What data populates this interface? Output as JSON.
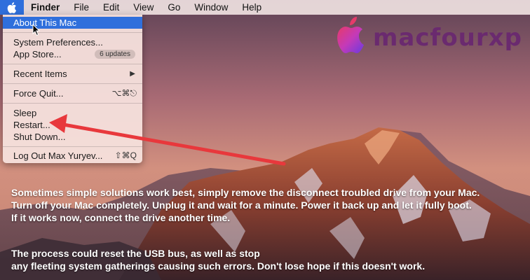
{
  "menubar": {
    "items": [
      "Finder",
      "File",
      "Edit",
      "View",
      "Go",
      "Window",
      "Help"
    ]
  },
  "apple_menu": {
    "about": "About This Mac",
    "system_preferences": "System Preferences...",
    "app_store": "App Store...",
    "app_store_badge": "6 updates",
    "recent_items": "Recent Items",
    "recent_items_arrow": "▶",
    "force_quit": "Force Quit...",
    "force_quit_shortcut": "⌥⌘⎋",
    "sleep": "Sleep",
    "restart": "Restart...",
    "shut_down": "Shut Down...",
    "log_out": "Log Out Max Yuryev...",
    "log_out_shortcut": "⇧⌘Q"
  },
  "watermark": {
    "text": "macfourxp"
  },
  "caption": {
    "line1": "Sometimes simple solutions work best, simply remove the disconnect troubled drive from your Mac.",
    "line2": "Turn off your Mac completely. Unplug it and wait for a minute. Power it back up and let it fully boot.",
    "line3": "If it works now, connect the drive another time.",
    "line4": "The process could reset the USB bus, as well as stop",
    "line5": "any fleeting system gatherings causing such errors. Don't lose hope if this doesn't work."
  },
  "colors": {
    "highlight": "#2f6fdc",
    "annotation_arrow": "#e8383c",
    "watermark": "#6a2a6f"
  }
}
